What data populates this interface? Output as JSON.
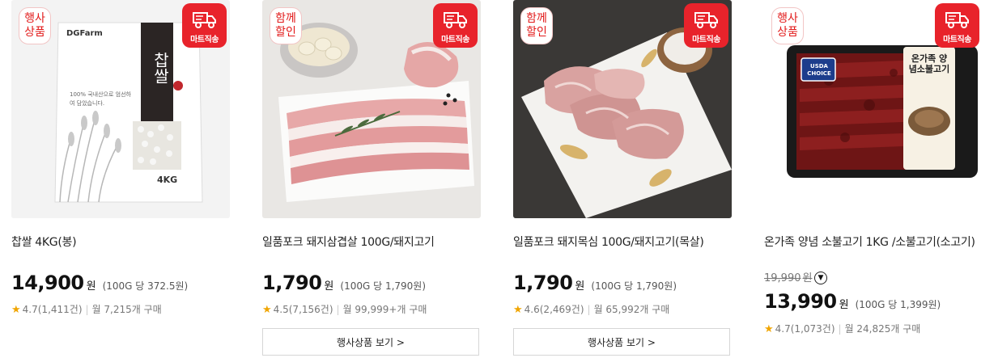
{
  "badges": {
    "mart_label": "마트직송",
    "event_label": "행사상품",
    "together_label": "함께할인"
  },
  "products": [
    {
      "event_badge": "행사상품",
      "name": "찹쌀 4KG(봉)",
      "price": "14,900",
      "won": "원",
      "unit_price": "(100G 당 372.5원)",
      "rating": "4.7",
      "reviews": "(1,411건)",
      "sold": "월 7,215개 구매",
      "package_brand": "DGFarm",
      "package_title": "찹쌀",
      "package_sub": "100% 국내산으로 엄선하여 담았습니다.",
      "package_weight": "4KG"
    },
    {
      "event_badge": "함께할인",
      "name": "일품포크 돼지삼겹살 100G/돼지고기",
      "price": "1,790",
      "won": "원",
      "unit_price": "(100G 당 1,790원)",
      "rating": "4.5",
      "reviews": "(7,156건)",
      "sold": "월 99,999+개 구매",
      "button": "행사상품 보기 >"
    },
    {
      "event_badge": "함께할인",
      "name": "일품포크 돼지목심 100G/돼지고기(목살)",
      "price": "1,790",
      "won": "원",
      "unit_price": "(100G 당 1,790원)",
      "rating": "4.6",
      "reviews": "(2,469건)",
      "sold": "월 65,992개 구매",
      "button": "행사상품 보기 >"
    },
    {
      "event_badge": "행사상품",
      "name": "온가족 양념 소불고기 1KG /소불고기(소고기)",
      "original_price": "19,990",
      "original_won": "원",
      "price": "13,990",
      "won": "원",
      "unit_price": "(100G 당 1,399원)",
      "rating": "4.7",
      "reviews": "(1,073건)",
      "sold": "월 24,825개 구매",
      "package_label": "온가족 양념소불고기",
      "package_tag": "USDA CHOICE"
    }
  ],
  "colors": {
    "accent": "#e8232b",
    "star": "#f0a500"
  }
}
